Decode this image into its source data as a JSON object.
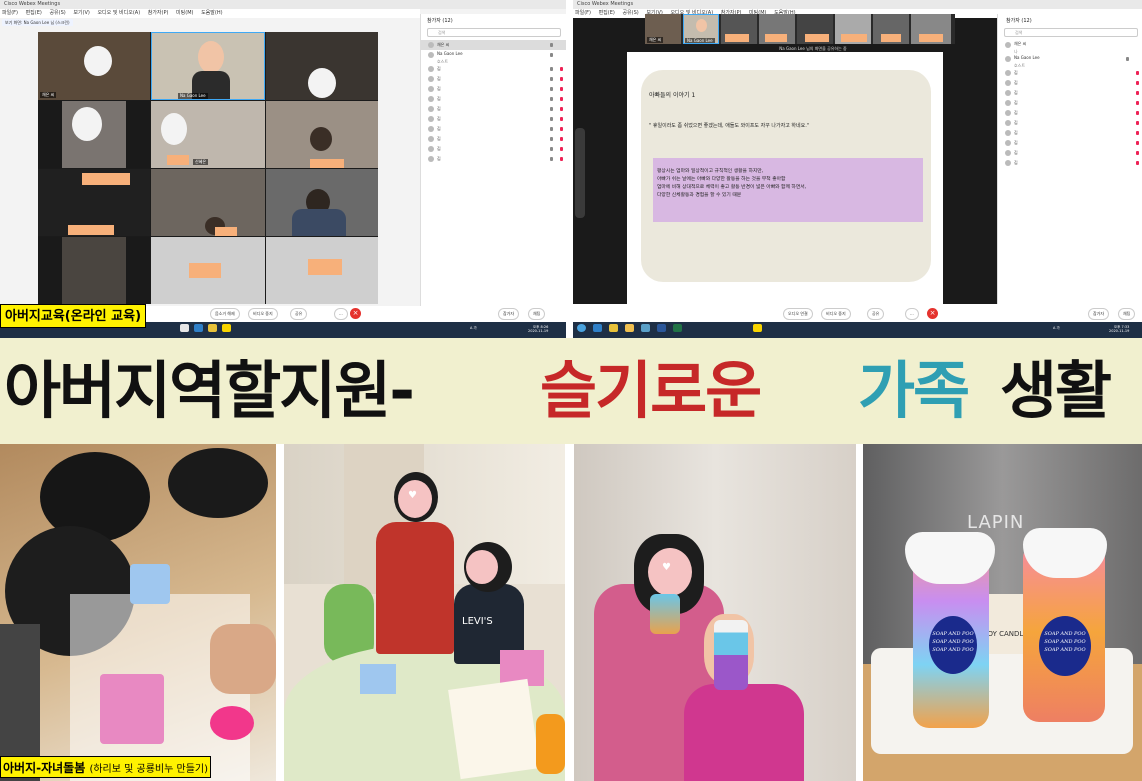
{
  "left_screen": {
    "titlebar": "Cisco Webex Meetings",
    "menus": [
      "파일(F)",
      "편집(E)",
      "공유(S)",
      "보기(V)",
      "오디오 및 비디오(A)",
      "참가자(P)",
      "미팅(M)",
      "도움말(H)"
    ],
    "status": "보기 화면: Na Gaon Lee 님 (스크린)",
    "main_tile_name": "Na Gaon Lee",
    "tile_small_name": "채은 씨",
    "tile_name_2": "신혜은",
    "participants_title": "참가자 (12)",
    "search_placeholder": "검색",
    "participants": [
      {
        "name": "채은 씨",
        "sub": "나"
      },
      {
        "name": "Na Gaon Lee",
        "sub": "호스트"
      },
      {
        "name": "김",
        "sub": ""
      },
      {
        "name": "김",
        "sub": ""
      },
      {
        "name": "김",
        "sub": ""
      },
      {
        "name": "김",
        "sub": ""
      },
      {
        "name": "김",
        "sub": ""
      },
      {
        "name": "김",
        "sub": ""
      },
      {
        "name": "김",
        "sub": ""
      },
      {
        "name": "김",
        "sub": ""
      },
      {
        "name": "김",
        "sub": ""
      },
      {
        "name": "김",
        "sub": ""
      }
    ],
    "controls": [
      "음소거 해제",
      "비디오 중지",
      "공유",
      "..."
    ],
    "panel_controls": [
      "참가자",
      "채팅"
    ],
    "clock_time": "오후 8:26",
    "clock_date": "2020-11-19",
    "tray_lang": "A 가"
  },
  "right_screen": {
    "titlebar": "Cisco Webex Meetings",
    "menus": [
      "파일(F)",
      "편집(E)",
      "공유(S)",
      "보기(V)",
      "오디오 및 비디오(A)",
      "참가자(P)",
      "미팅(M)",
      "도움말(H)"
    ],
    "share_status": "Na Gaon Lee 님의 화면을 공유하는 중",
    "thumb_name_1": "채은 씨",
    "thumb_name_2": "Na Gaon Lee",
    "slide_title": "아빠들의 이야기 1",
    "slide_quote": "\" 휴일이라도 좀 쉬었으면 좋겠는데, 애들도 와이프도 자꾸 나가자고 하네요.\"",
    "slide_box": [
      "평상시는 엄마와 일상적이고 규칙적인 생활을 하지만,",
      "아빠가 쉬는 날에는 아빠와 다양한 활동을 하는 것을 무척 좋아함",
      "엄마에 비해 상대적으로 체력이 좋고 활동 반경이 넓은 아빠와 함께 하면서,",
      "다양한 신체활동과 경험을 할 수 있기 때문"
    ],
    "participants_title": "참가자 (12)",
    "search_placeholder": "검색",
    "participants": [
      {
        "name": "채은 씨",
        "sub": "나"
      },
      {
        "name": "Na Gaon Lee",
        "sub": "호스트"
      },
      {
        "name": "김",
        "sub": ""
      },
      {
        "name": "김",
        "sub": ""
      },
      {
        "name": "김",
        "sub": ""
      },
      {
        "name": "김",
        "sub": ""
      },
      {
        "name": "김",
        "sub": ""
      },
      {
        "name": "김",
        "sub": ""
      },
      {
        "name": "김",
        "sub": ""
      },
      {
        "name": "김",
        "sub": ""
      },
      {
        "name": "김",
        "sub": ""
      },
      {
        "name": "김",
        "sub": ""
      }
    ],
    "controls": [
      "오디오 연결",
      "비디오 중지",
      "공유",
      "..."
    ],
    "panel_controls": [
      "참가자",
      "채팅"
    ],
    "clock_time": "오후 7:33",
    "clock_date": "2020-11-19",
    "tray_lang": "A 가"
  },
  "labels": {
    "online": "아버지교육(온라인 교육)",
    "care_main": "아버지-자녀돌봄",
    "care_sub": "(하리보 및 공룡비누 만들기)"
  },
  "banner": {
    "part1": "아버지역할지원-",
    "part2": "슬기로운",
    "part3": "가족",
    "part4": "생활",
    "colors": {
      "part1": "#111111",
      "part2": "#c62828",
      "part3": "#2f9fb3",
      "part4": "#111111",
      "bg": "#f1f0cf"
    }
  },
  "photos": {
    "bag_text": "LAPIN",
    "candle_text": "SOY CANDLE",
    "soap_label": [
      "SOAP AND POO",
      "SOAP AND POO",
      "SOAP AND POO"
    ],
    "levis": "LEVI'S"
  }
}
